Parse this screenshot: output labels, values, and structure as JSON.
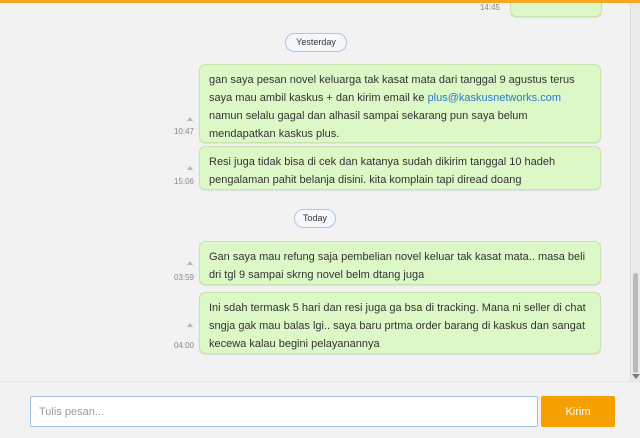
{
  "previous_message": {
    "time": "14:45"
  },
  "days": [
    {
      "label": "Yesterday"
    },
    {
      "label": "Today"
    }
  ],
  "messages": [
    {
      "time": "10:47",
      "text_before_link": "gan saya pesan novel keluarga tak kasat mata dari tanggal 9 agustus terus saya mau ambil kaskus + dan kirim email ke ",
      "link": "plus@kaskusnetworks.com",
      "text_after_link": " namun selalu gagal dan alhasil sampai sekarang pun saya belum mendapatkan kaskus plus."
    },
    {
      "time": "15:06",
      "text": "Resi juga tidak bisa di cek dan katanya sudah dikirim tanggal 10 hadeh pengalaman pahit belanja disini. kita komplain tapi diread doang"
    },
    {
      "time": "03:59",
      "text": "Gan  saya mau refung saja pembelian novel keluar tak kasat mata.. masa beli dri tgl 9 sampai skrng novel belm dtang juga"
    },
    {
      "time": "04:00",
      "text": "Ini sdah termask 5 hari dan resi juga ga bsa di tracking. Mana ni seller di chat sngja gak mau balas lgi.. saya baru prtma order barang di kaskus dan sangat kecewa kalau begini pelayanannya"
    }
  ],
  "composer": {
    "placeholder": "Tulis pesan...",
    "send_label": "Kirim"
  },
  "colors": {
    "accent": "#f5a000",
    "bubble": "#dcf8c6",
    "input_border": "#9fc2e6"
  }
}
